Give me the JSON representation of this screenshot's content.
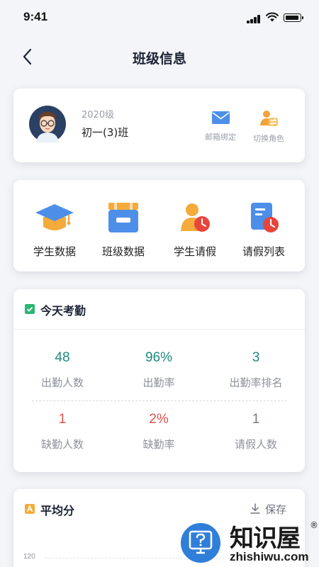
{
  "status_bar": {
    "time": "9:41"
  },
  "nav": {
    "title": "班级信息",
    "back_icon": "chevron-left-icon"
  },
  "class_card": {
    "grade": "2020级",
    "class_name": "初一(3)班",
    "actions": [
      {
        "label": "邮箱绑定",
        "icon": "mail-icon"
      },
      {
        "label": "切换角色",
        "icon": "switch-role-icon"
      }
    ]
  },
  "functions": [
    {
      "label": "学生数据",
      "icon": "graduation-cap-icon"
    },
    {
      "label": "班级数据",
      "icon": "class-box-icon"
    },
    {
      "label": "学生请假",
      "icon": "student-leave-icon"
    },
    {
      "label": "请假列表",
      "icon": "leave-list-icon"
    }
  ],
  "attendance": {
    "title": "今天考勤",
    "stats": [
      {
        "value": "48",
        "label": "出勤人数",
        "color": "#1a8a7e"
      },
      {
        "value": "96%",
        "label": "出勤率",
        "color": "#1a8a7e"
      },
      {
        "value": "3",
        "label": "出勤率排名",
        "color": "#1a8a7e"
      },
      {
        "value": "1",
        "label": "缺勤人数",
        "color": "#d9534f"
      },
      {
        "value": "2%",
        "label": "缺勤率",
        "color": "#d9534f"
      },
      {
        "value": "1",
        "label": "请假人数",
        "color": "#777b84"
      }
    ]
  },
  "average": {
    "title": "平均分",
    "save_label": "保存",
    "y_tick": "120"
  },
  "watermark": {
    "brand": "知识屋",
    "reg": "®",
    "domain": "zhishiwu.com"
  },
  "colors": {
    "accent": "#f0a43a",
    "green": "#1a8a7e",
    "red": "#d9534f",
    "blue": "#3b7fe0"
  }
}
